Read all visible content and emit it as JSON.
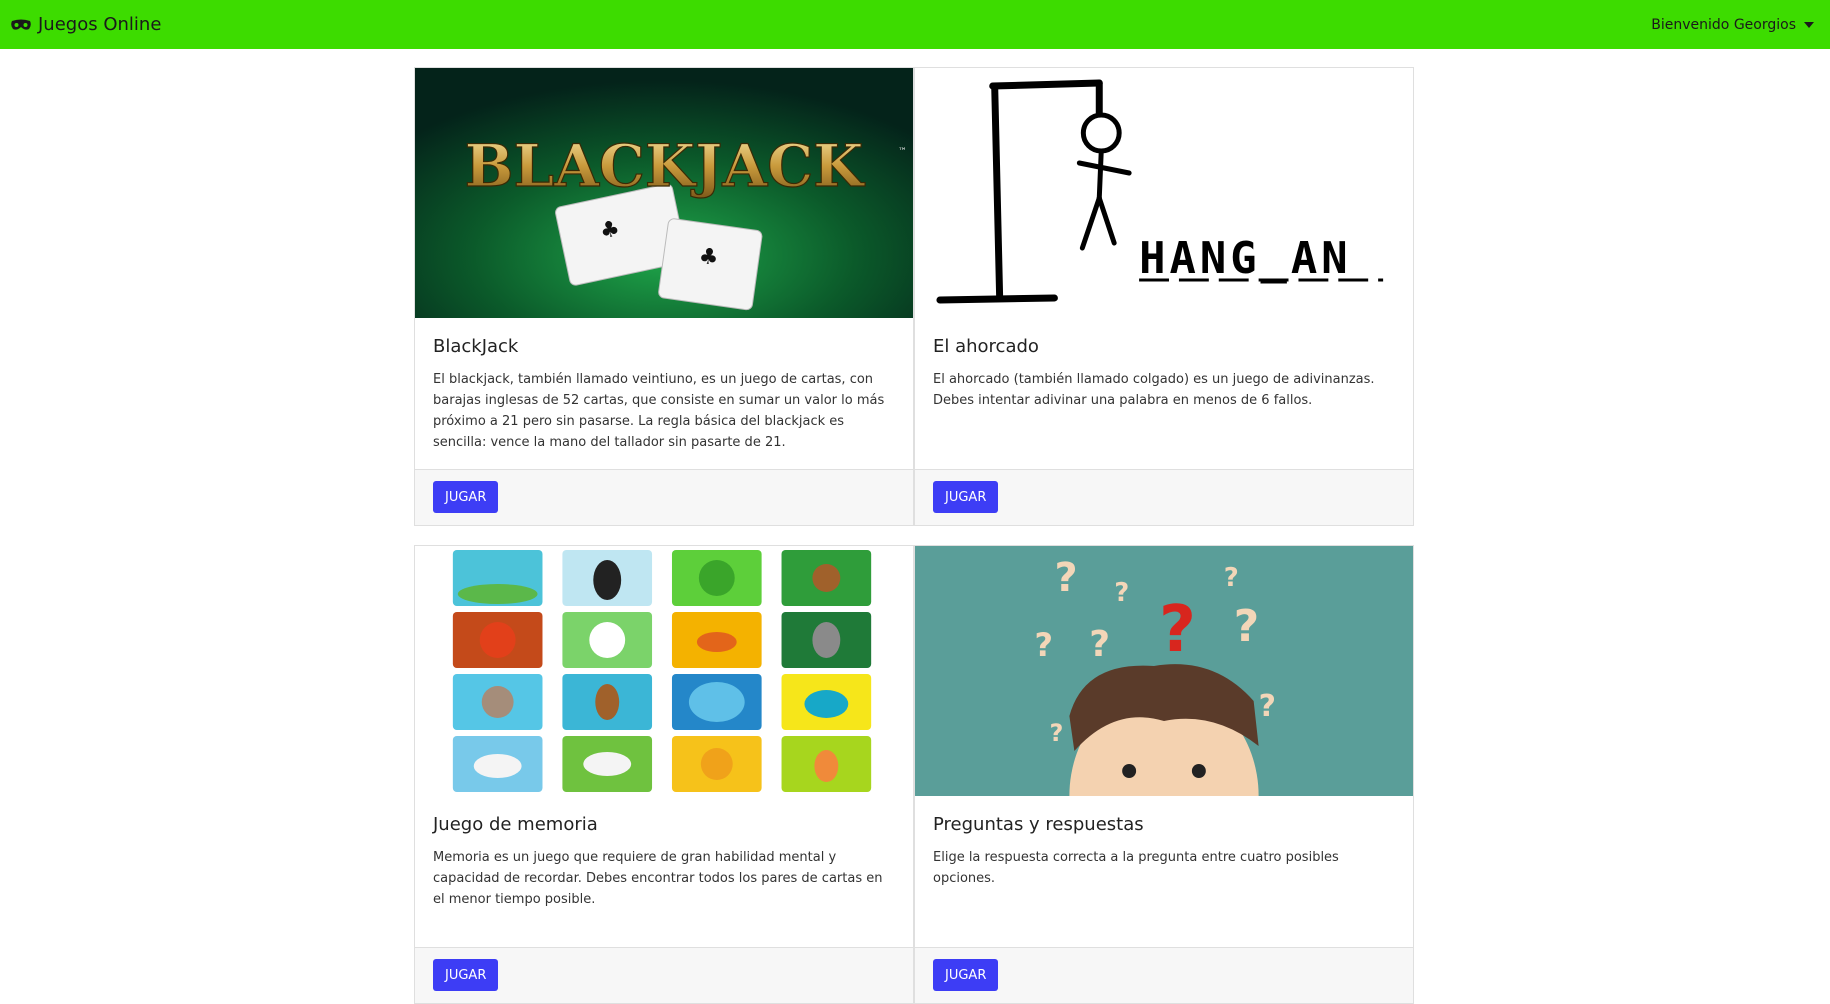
{
  "navbar": {
    "brand": "Juegos Online",
    "user_menu": "Bienvenido Georgios"
  },
  "games": [
    {
      "title": "BlackJack",
      "description": "El blackjack, también llamado veintiuno, es un juego de cartas, con barajas inglesas de 52 cartas, que consiste en sumar un valor lo más próximo a 21 pero sin pasarse. La regla básica del blackjack es sencilla: vence la mano del tallador sin pasarte de 21.",
      "button": "JUGAR",
      "image_label": "BLACKJACK"
    },
    {
      "title": "El ahorcado",
      "description": "El ahorcado (también llamado colgado) es un juego de adivinanzas. Debes intentar adivinar una palabra en menos de 6 fallos.",
      "button": "JUGAR",
      "image_label": "HANG_AN"
    },
    {
      "title": "Juego de memoria",
      "description": "Memoria es un juego que requiere de gran habilidad mental y capacidad de recordar. Debes encontrar todos los pares de cartas en el menor tiempo posible.",
      "button": "JUGAR"
    },
    {
      "title": "Preguntas y respuestas",
      "description": "Elige la respuesta correcta a la pregunta entre cuatro posibles opciones.",
      "button": "JUGAR"
    }
  ],
  "colors": {
    "navbar": "#3ddc00",
    "button": "#3d3df5",
    "quiz_bg": "#5a9e99"
  },
  "icons": {
    "brand": "gamepad-mask-icon",
    "user_menu": "caret-down-icon"
  }
}
